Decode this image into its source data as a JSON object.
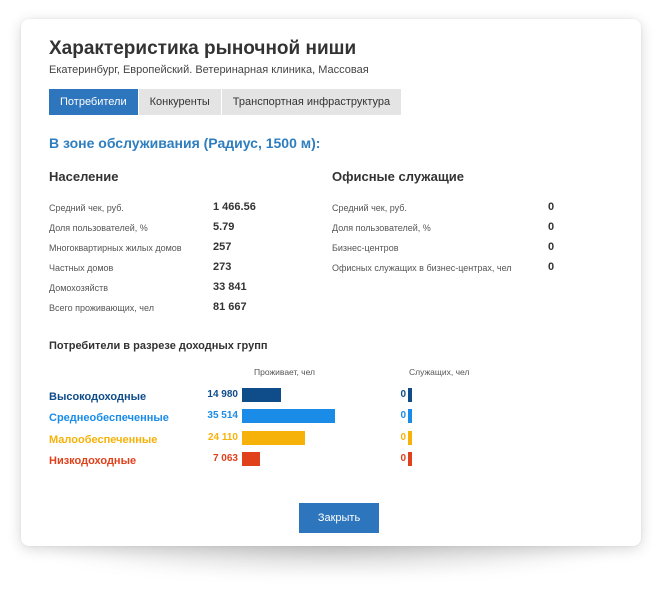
{
  "modal": {
    "title": "Характеристика рыночной ниши",
    "subtitle": "Екатеринбург, Европейский. Ветеринарная клиника, Массовая",
    "close_label": "Закрыть"
  },
  "tabs": [
    {
      "label": "Потребители",
      "active": true
    },
    {
      "label": "Конкуренты",
      "active": false
    },
    {
      "label": "Транспортная инфраструктура",
      "active": false
    }
  ],
  "section_title": "В зоне обслуживания (Радиус, 1500 м):",
  "population": {
    "title": "Население",
    "rows": [
      {
        "label": "Средний чек, руб.",
        "value": "1 466.56"
      },
      {
        "label": "Доля пользователей, %",
        "value": "5.79"
      },
      {
        "label": "Многоквартирных жилых домов",
        "value": "257"
      },
      {
        "label": "Частных домов",
        "value": "273"
      },
      {
        "label": "Домохозяйств",
        "value": "33 841"
      },
      {
        "label": "Всего проживающих, чел",
        "value": "81 667"
      }
    ]
  },
  "office": {
    "title": "Офисные служащие",
    "rows": [
      {
        "label": "Средний чек, руб.",
        "value": "0"
      },
      {
        "label": "Доля пользователей, %",
        "value": "0"
      },
      {
        "label": "Бизнес-центров",
        "value": "0"
      },
      {
        "label": "Офисных служащих в бизнес-центрах, чел",
        "value": "0"
      }
    ]
  },
  "income_groups": {
    "title": "Потребители в разрезе доходных групп",
    "col_residents": "Проживает, чел",
    "col_employees": "Служащих, чел",
    "max_residents": 35514,
    "groups": [
      {
        "label": "Высокодоходные",
        "residents": 14980,
        "residents_label": "14 980",
        "employees": 0,
        "employees_label": "0",
        "color": "#0f4c8a"
      },
      {
        "label": "Среднеобеспеченные",
        "residents": 35514,
        "residents_label": "35 514",
        "employees": 0,
        "employees_label": "0",
        "color": "#1a8ce8"
      },
      {
        "label": "Малообеспеченные",
        "residents": 24110,
        "residents_label": "24 110",
        "employees": 0,
        "employees_label": "0",
        "color": "#f7b20a"
      },
      {
        "label": "Низкодоходные",
        "residents": 7063,
        "residents_label": "7 063",
        "employees": 0,
        "employees_label": "0",
        "color": "#e0401a"
      }
    ]
  }
}
